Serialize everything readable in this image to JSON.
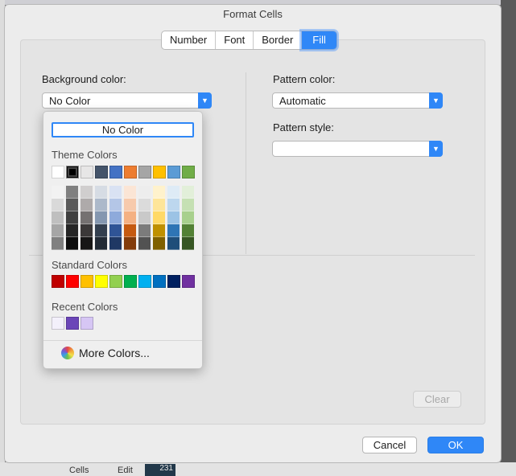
{
  "window": {
    "title": "Format Cells"
  },
  "tabs": [
    {
      "label": "Number"
    },
    {
      "label": "Font"
    },
    {
      "label": "Border"
    },
    {
      "label": "Fill",
      "active": true
    }
  ],
  "fill": {
    "background_color_label": "Background color:",
    "background_color_value": "No Color",
    "pattern_color_label": "Pattern color:",
    "pattern_color_value": "Automatic",
    "pattern_style_label": "Pattern style:",
    "pattern_style_value": ""
  },
  "palette": {
    "no_color_label": "No Color",
    "theme_colors_label": "Theme Colors",
    "theme_colors": [
      "#ffffff",
      "#000000",
      "#e7e6e6",
      "#44546a",
      "#4472c4",
      "#ed7d31",
      "#a5a5a5",
      "#ffc000",
      "#5b9bd5",
      "#70ad47"
    ],
    "theme_shades": [
      [
        "#f2f2f2",
        "#d9d9d9",
        "#bfbfbf",
        "#a6a6a6",
        "#808080"
      ],
      [
        "#7f7f7f",
        "#595959",
        "#404040",
        "#262626",
        "#0d0d0d"
      ],
      [
        "#d0cece",
        "#aeaaaa",
        "#757171",
        "#3b3838",
        "#171616"
      ],
      [
        "#d6dce4",
        "#acb9ca",
        "#8497b0",
        "#333f4f",
        "#222a35"
      ],
      [
        "#d9e2f3",
        "#b4c6e7",
        "#8eaadb",
        "#2f5496",
        "#1f3864"
      ],
      [
        "#fbe5d5",
        "#f7caac",
        "#f4b183",
        "#c55a11",
        "#833c0b"
      ],
      [
        "#ededed",
        "#dbdbdb",
        "#c9c9c9",
        "#7b7b7b",
        "#525252"
      ],
      [
        "#fff2cc",
        "#fee599",
        "#ffd966",
        "#bf9000",
        "#7f6000"
      ],
      [
        "#deebf6",
        "#bdd7ee",
        "#9cc3e5",
        "#2e75b5",
        "#1f4e79"
      ],
      [
        "#e2efd9",
        "#c5e0b3",
        "#a8d08d",
        "#538135",
        "#375623"
      ]
    ],
    "standard_colors_label": "Standard Colors",
    "standard_colors": [
      "#c00000",
      "#ff0000",
      "#ffc000",
      "#ffff00",
      "#92d050",
      "#00b050",
      "#00b0f0",
      "#0070c0",
      "#002060",
      "#7030a0"
    ],
    "recent_colors_label": "Recent Colors",
    "recent_colors": [
      "#f3f0fb",
      "#6b45b8",
      "#d6c6f4"
    ],
    "more_colors_label": "More Colors..."
  },
  "buttons": {
    "clear_label": "Clear",
    "cancel_label": "Cancel",
    "ok_label": "OK"
  },
  "background_app": {
    "cells_label": "Cells",
    "edit_label": "Edit",
    "cell_value": "231"
  }
}
